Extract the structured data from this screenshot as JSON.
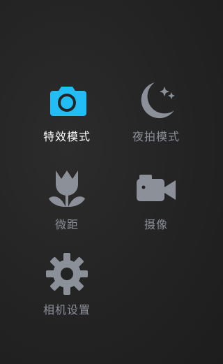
{
  "colors": {
    "accent": "#23bdf5",
    "icon_inactive": "#8b9099",
    "label_active": "#ffffff",
    "label_inactive": "#8b9099"
  },
  "modes": [
    {
      "id": "special",
      "label": "特效模式",
      "icon": "camera-icon",
      "active": true
    },
    {
      "id": "night",
      "label": "夜拍模式",
      "icon": "moon-stars-icon",
      "active": false
    },
    {
      "id": "macro",
      "label": "微距",
      "icon": "tulip-icon",
      "active": false
    },
    {
      "id": "video",
      "label": "摄像",
      "icon": "video-camera-icon",
      "active": false
    },
    {
      "id": "settings",
      "label": "相机设置",
      "icon": "gear-icon",
      "active": false
    }
  ]
}
